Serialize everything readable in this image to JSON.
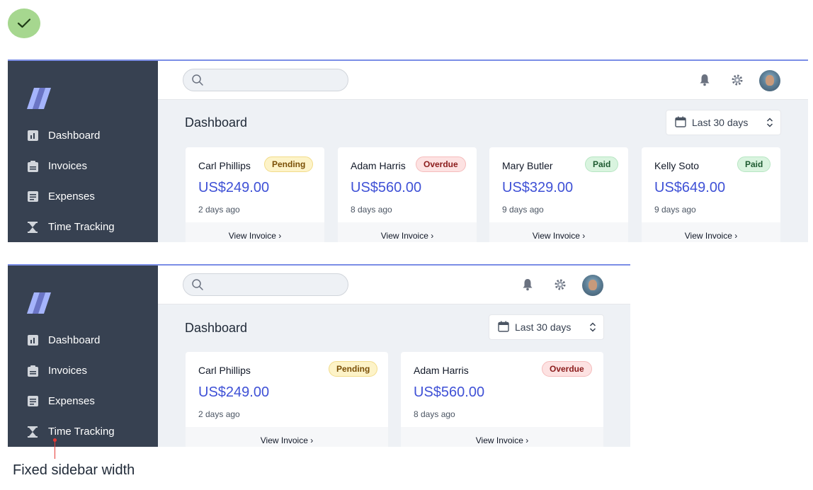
{
  "colors": {
    "accent": "#3f51d6",
    "sidebar_bg": "#374151",
    "top_border": "#7b8ee6",
    "check_bg": "#a6d78f",
    "annotation": "#e53935"
  },
  "status_icon": "check-icon",
  "search": {
    "placeholder": ""
  },
  "header_icons": [
    "bell-icon",
    "gear-icon",
    "avatar"
  ],
  "sidebar": {
    "items": [
      {
        "label": "Dashboard",
        "icon": "chart-icon"
      },
      {
        "label": "Invoices",
        "icon": "invoice-icon"
      },
      {
        "label": "Expenses",
        "icon": "receipt-icon"
      },
      {
        "label": "Time Tracking",
        "icon": "hourglass-icon"
      }
    ]
  },
  "main": {
    "title": "Dashboard",
    "date_range": "Last 30 days",
    "view_label": "View Invoice",
    "cards": [
      {
        "name": "Carl Phillips",
        "status": "Pending",
        "amount": "US$249.00",
        "when": "2 days ago"
      },
      {
        "name": "Adam Harris",
        "status": "Overdue",
        "amount": "US$560.00",
        "when": "8 days ago"
      },
      {
        "name": "Mary Butler",
        "status": "Paid",
        "amount": "US$329.00",
        "when": "9 days ago"
      },
      {
        "name": "Kelly Soto",
        "status": "Paid",
        "amount": "US$649.00",
        "when": "9 days ago"
      }
    ]
  },
  "annotation": {
    "text": "Fixed sidebar width"
  }
}
